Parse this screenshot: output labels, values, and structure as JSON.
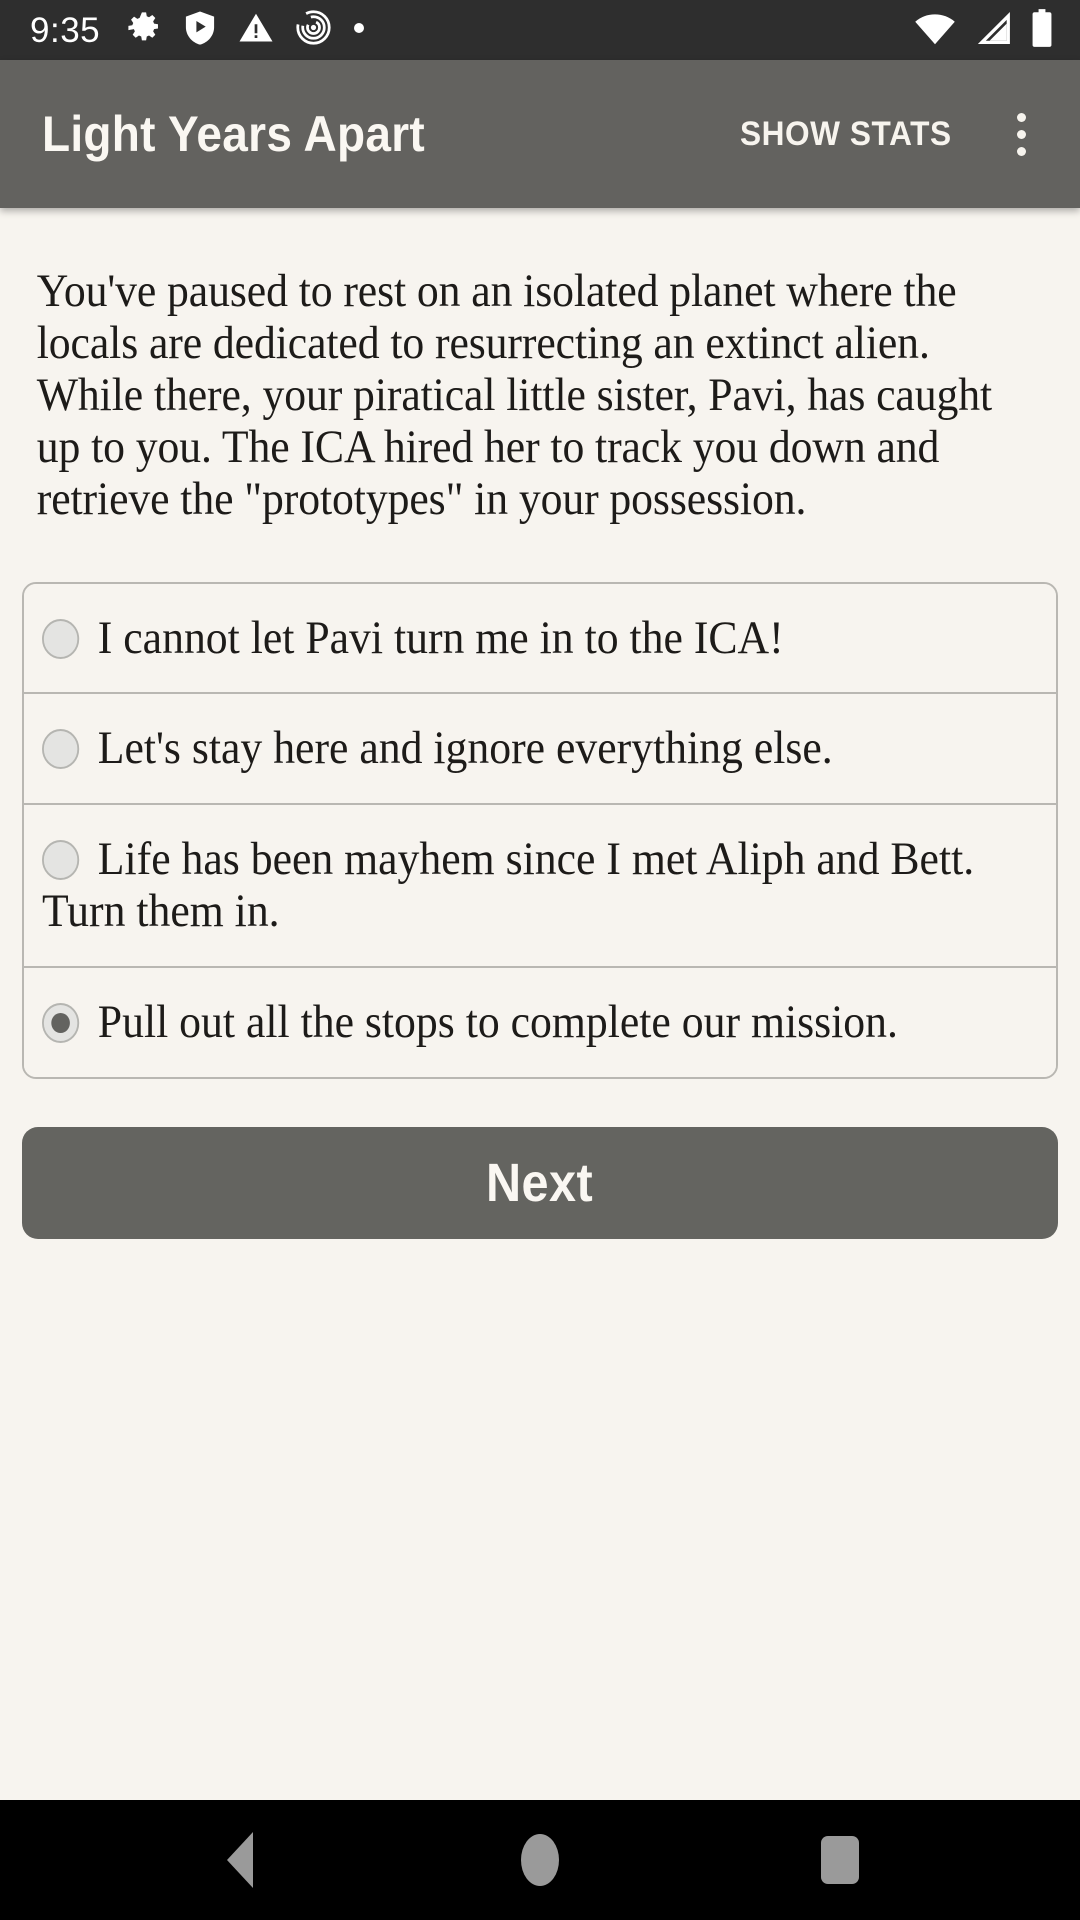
{
  "status_bar": {
    "time": "9:35",
    "left_icons": [
      "gear-icon",
      "play-protect-shield-icon",
      "warning-triangle-icon",
      "labyrinth-icon",
      "dot-icon"
    ],
    "right_icons": [
      "wifi-icon",
      "cellular-signal-icon",
      "battery-icon"
    ],
    "background_color": "#2e2e2e"
  },
  "app_bar": {
    "title": "Light Years Apart",
    "show_stats_label": "SHOW STATS",
    "overflow_label": "more-options",
    "background_color": "#63625f",
    "text_color": "#faf7f2"
  },
  "main": {
    "story_text": "You've paused to rest on an isolated planet where the locals are dedicated to resurrecting an extinct alien. While there, your piratical little sister, Pavi, has caught up to you. The ICA hired her to track you down and retrieve the \"prototypes\" in your possession.",
    "options": [
      {
        "label": "I cannot let Pavi turn me in to the ICA!",
        "selected": false
      },
      {
        "label": "Let's stay here and ignore everything else.",
        "selected": false
      },
      {
        "label": "Life has been mayhem since I met Aliph and Bett. Turn them in.",
        "selected": false
      },
      {
        "label": "Pull out all the stops to complete our mission.",
        "selected": true
      }
    ],
    "next_label": "Next",
    "background_color": "#f7f4ef",
    "accent_color": "#646460"
  },
  "nav_bar": {
    "back_label": "back-button",
    "home_label": "home-button",
    "recents_label": "recents-button",
    "background_color": "#000000",
    "icon_color": "#9a9a9a"
  }
}
